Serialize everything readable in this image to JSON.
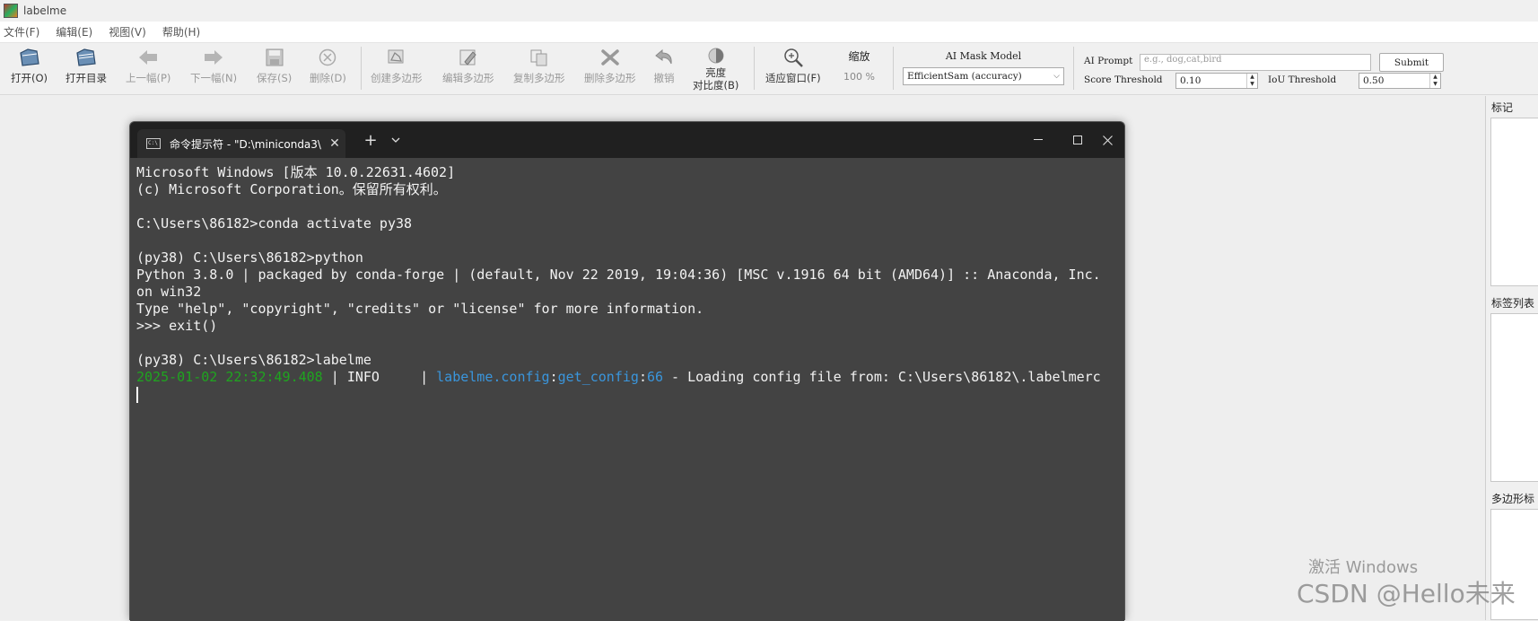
{
  "window": {
    "title": "labelme"
  },
  "menu": [
    {
      "label": "文件(F)"
    },
    {
      "label": "编辑(E)"
    },
    {
      "label": "视图(V)"
    },
    {
      "label": "帮助(H)"
    }
  ],
  "toolbar": {
    "open": "打开(O)",
    "open_dir": "打开目录",
    "prev": "上一幅(P)",
    "next": "下一幅(N)",
    "save": "保存(S)",
    "delete": "删除(D)",
    "create_poly": "创建多边形",
    "edit_poly": "编辑多边形",
    "copy_poly": "复制多边形",
    "delete_poly": "删除多边形",
    "undo": "撤销",
    "brightness_1": "亮度",
    "brightness_2": "对比度(B)",
    "fit_window": "适应窗口(F)",
    "zoom_label": "缩放",
    "zoom_value": "100 %",
    "ai_mask_label": "AI Mask Model",
    "ai_mask_value": "EfficientSam (accuracy)",
    "ai_prompt_label": "AI Prompt",
    "ai_prompt_placeholder": "e.g., dog,cat,bird",
    "submit": "Submit",
    "score_label": "Score Threshold",
    "score_value": "0.10",
    "iou_label": "IoU Threshold",
    "iou_value": "0.50"
  },
  "dock": {
    "flags_title": "标记",
    "labels_title": "标签列表",
    "polygons_title": "多边形标"
  },
  "terminal": {
    "tab_title": "命令提示符 - \"D:\\miniconda3\\",
    "lines": [
      "Microsoft Windows [版本 10.0.22631.4602]",
      "(c) Microsoft Corporation。保留所有权利。",
      "",
      "C:\\Users\\86182>conda activate py38",
      "",
      "(py38) C:\\Users\\86182>python",
      "Python 3.8.0 | packaged by conda-forge | (default, Nov 22 2019, 19:04:36) [MSC v.1916 64 bit (AMD64)] :: Anaconda, Inc.",
      "on win32",
      "Type \"help\", \"copyright\", \"credits\" or \"license\" for more information.",
      ">>> exit()",
      "",
      "(py38) C:\\Users\\86182>labelme"
    ],
    "log": {
      "timestamp": "2025-01-02 22:32:49.408",
      "sep1": " | ",
      "level": "INFO    ",
      "sep2": " | ",
      "module": "labelme.config",
      "colon1": ":",
      "func": "get_config",
      "colon2": ":",
      "lineno": "66",
      "message": " - Loading config file from: C:\\Users\\86182\\.labelmerc"
    }
  },
  "watermark": {
    "activate": "激活 Windows",
    "csdn": "CSDN @Hello未来"
  }
}
